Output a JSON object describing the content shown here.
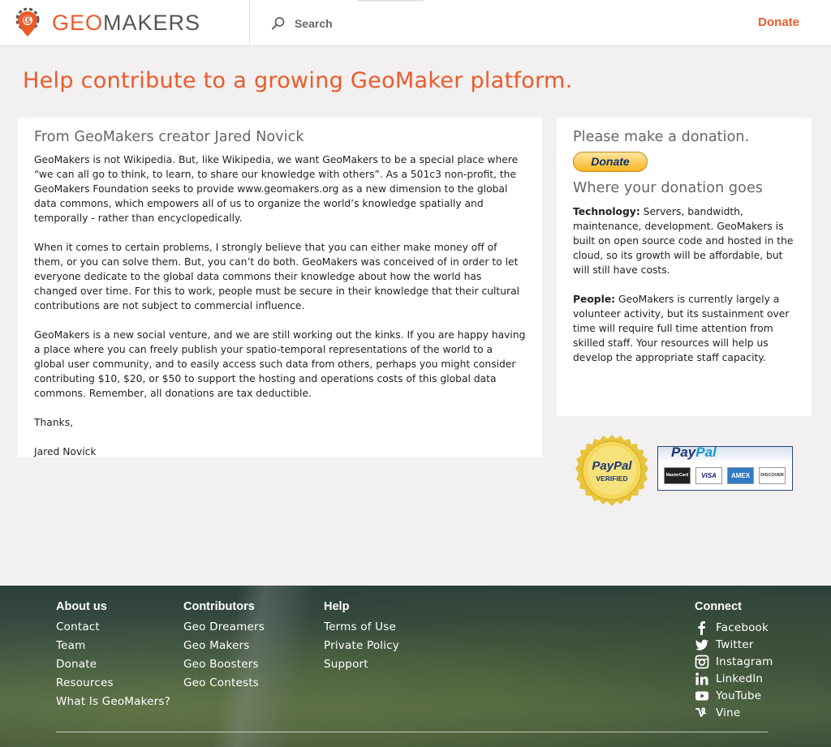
{
  "header": {
    "logo": {
      "geo": "GEO",
      "makers": "MAKERS"
    },
    "search_placeholder": "Search",
    "donate_label": "Donate"
  },
  "page_title": "Help contribute to a growing GeoMaker platform.",
  "letter": {
    "heading": "From GeoMakers creator Jared Novick",
    "paragraphs": [
      "GeoMakers is not Wikipedia. But, like Wikipedia, we want GeoMakers to be a special place where “we can all go to think, to learn, to share our knowledge with others”. As a 501c3 non-profit, the GeoMakers Foundation seeks to provide www.geomakers.org as a new dimension to the global data commons, which empowers all of us to organize the world’s knowledge spatially and temporally - rather than encyclopedically.",
      "When it comes to certain problems, I strongly believe that you can either make money off of them, or you can solve them. But, you can’t do both. GeoMakers was conceived of in order to let everyone dedicate to the global data commons their knowledge about how the world has changed over time. For this to work, people must be secure in their knowledge that their cultural contributions are not subject to commercial influence.",
      "GeoMakers is a new social venture, and we are still working out the kinks. If you are happy having a place where you can freely publish your spatio-temporal representations of the world to a global user community, and to easily access such data from others, perhaps you might consider contributing $10, $20, or $50 to support the hosting and operations costs of this global data commons. Remember, all donations are tax deductible.",
      "Thanks,",
      "Jared Novick"
    ]
  },
  "donation": {
    "heading": "Please make a donation.",
    "button_label": "Donate",
    "subheading": "Where your donation goes",
    "technology_label": "Technology:",
    "technology_text": " Servers, bandwidth, maintenance, development. GeoMakers is built on open source code and hosted in the cloud, so its growth will be affordable, but will still have costs.",
    "people_label": "People:",
    "people_text": " GeoMakers is currently largely a volunteer activity, but its sustainment over time will require full time attention from skilled staff. Your resources will help us develop the appropriate staff capacity."
  },
  "badges": {
    "seal_top": "PayPal",
    "seal_bottom": "VERIFIED",
    "paypal_pay": "Pay",
    "paypal_pal": "Pal",
    "cards": [
      "MasterCard",
      "VISA",
      "AMEX",
      "DISCOVER"
    ]
  },
  "footer": {
    "about": {
      "title": "About us",
      "links": [
        "Contact",
        "Team",
        "Donate",
        "Resources",
        "What Is GeoMakers?"
      ]
    },
    "contributors": {
      "title": "Contributors",
      "links": [
        "Geo Dreamers",
        "Geo Makers",
        "Geo Boosters",
        "Geo Contests"
      ]
    },
    "help": {
      "title": "Help",
      "links": [
        "Terms of Use",
        "Private Policy",
        "Support"
      ]
    },
    "connect": {
      "title": "Connect",
      "links": [
        {
          "label": "Facebook",
          "icon": "facebook-icon"
        },
        {
          "label": "Twitter",
          "icon": "twitter-icon"
        },
        {
          "label": "Instagram",
          "icon": "instagram-icon"
        },
        {
          "label": "LinkedIn",
          "icon": "linkedin-icon"
        },
        {
          "label": "YouTube",
          "icon": "youtube-icon"
        },
        {
          "label": "Vine",
          "icon": "vine-icon"
        }
      ]
    }
  },
  "colors": {
    "accent": "#ec5a2a",
    "logo_gray": "#555555",
    "page_bg": "#f2f0f1"
  }
}
